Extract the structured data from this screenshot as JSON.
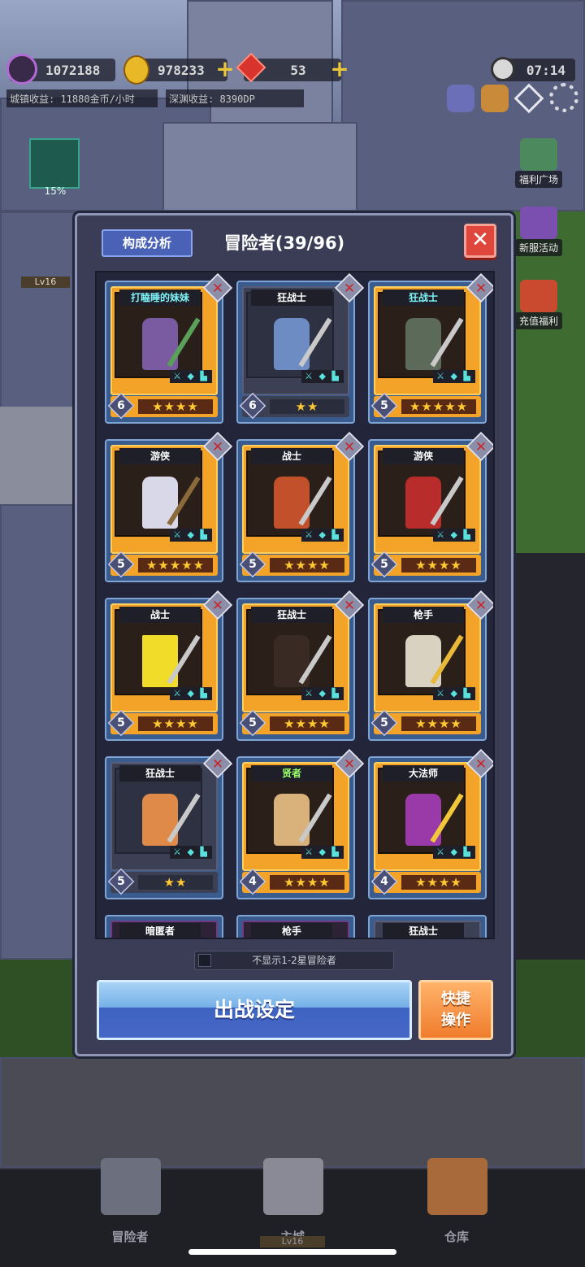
{
  "hud": {
    "soul_value": "1072188",
    "gold_value": "978233",
    "gem_value": "53",
    "time_value": "07:14",
    "town_income": "城镇收益: 11880金币/小时",
    "abyss_income": "深渊收益: 8390DP",
    "build_percent": "15%",
    "building_level": "Lv16"
  },
  "side_menu": [
    {
      "label": "福利广场"
    },
    {
      "label": "新服活动"
    },
    {
      "label": "充值福利"
    }
  ],
  "modal": {
    "analysis_label": "构成分析",
    "title": "冒险者(39/96)",
    "close_glyph": "✕",
    "remove_glyph": "✕",
    "equip_glyph": "⚔ ◆ ▙",
    "cards": [
      {
        "name": "打瞌睡的妹妹",
        "level": "6",
        "stars": "★★★★",
        "rarity": "gold",
        "name_color": "cyan"
      },
      {
        "name": "狂战士",
        "level": "6",
        "stars": "★★",
        "rarity": "gray",
        "name_color": "white"
      },
      {
        "name": "狂战士",
        "level": "5",
        "stars": "★★★★★",
        "rarity": "gold",
        "name_color": "cyan"
      },
      {
        "name": "游侠",
        "level": "5",
        "stars": "★★★★★",
        "rarity": "gold",
        "name_color": "white"
      },
      {
        "name": "战士",
        "level": "5",
        "stars": "★★★★",
        "rarity": "gold",
        "name_color": "white"
      },
      {
        "name": "游侠",
        "level": "5",
        "stars": "★★★★",
        "rarity": "gold",
        "name_color": "white"
      },
      {
        "name": "战士",
        "level": "5",
        "stars": "★★★★",
        "rarity": "gold",
        "name_color": "white"
      },
      {
        "name": "狂战士",
        "level": "5",
        "stars": "★★★★",
        "rarity": "gold",
        "name_color": "white"
      },
      {
        "name": "枪手",
        "level": "5",
        "stars": "★★★★",
        "rarity": "gold",
        "name_color": "white"
      },
      {
        "name": "狂战士",
        "level": "5",
        "stars": "★★",
        "rarity": "gray",
        "name_color": "white"
      },
      {
        "name": "贤者",
        "level": "4",
        "stars": "★★★★",
        "rarity": "gold",
        "name_color": "green"
      },
      {
        "name": "大法师",
        "level": "4",
        "stars": "★★★★",
        "rarity": "gold",
        "name_color": "white"
      }
    ],
    "partial_cards": [
      {
        "name": "暗匿者"
      },
      {
        "name": "枪手"
      },
      {
        "name": "狂战士"
      }
    ],
    "hide_low_star_label": "不显示1-2星冒险者",
    "deploy_label": "出战设定",
    "quick_label_1": "快捷",
    "quick_label_2": "操作"
  },
  "bottom_nav": {
    "adventurers": "冒险者",
    "main_city": "主城",
    "main_city_level": "Lv16",
    "warehouse": "仓库"
  },
  "colors": {
    "gold_card": "#f3a327",
    "gray_card": "#3b4055",
    "deploy_button": "#4766c7",
    "quick_button": "#f07c2d",
    "close_button": "#e0473c"
  }
}
